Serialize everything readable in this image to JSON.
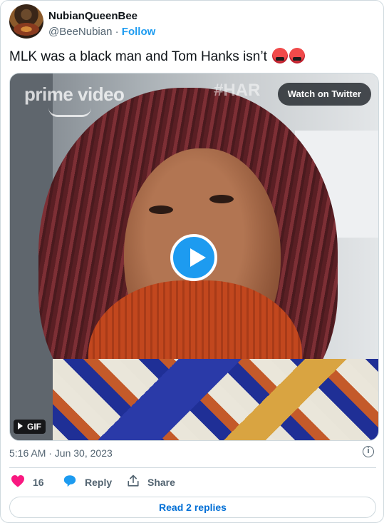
{
  "author": {
    "display_name": "NubianQueenBee",
    "handle": "@BeeNubian",
    "separator": "·",
    "follow_label": "Follow"
  },
  "tweet": {
    "text": "MLK was a black man and Tom Hanks isn’t",
    "emojis": [
      "face-with-symbols-on-mouth",
      "face-with-symbols-on-mouth"
    ]
  },
  "media": {
    "type": "GIF",
    "watch_label": "Watch on Twitter",
    "badge_label": "GIF",
    "watermark_primary": "prime video",
    "watermark_secondary": "#HAR"
  },
  "meta": {
    "timestamp": "5:16 AM · Jun 30, 2023"
  },
  "actions": {
    "like_count": "16",
    "reply_label": "Reply",
    "share_label": "Share"
  },
  "footer": {
    "read_replies_label": "Read 2 replies"
  },
  "colors": {
    "accent": "#1d9bf0",
    "like": "#f91880",
    "link": "#006fd6",
    "secondary_text": "#536471",
    "border": "#cfd9de"
  }
}
